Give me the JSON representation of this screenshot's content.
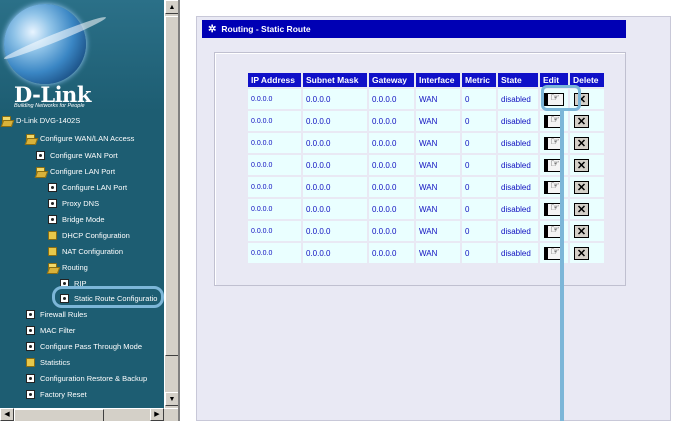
{
  "nav": {
    "brand": "D-Link",
    "tagline": "Building Networks for People",
    "tree": [
      {
        "label": "D-Link DVG-1402S",
        "icon": "folder-open-icon"
      },
      {
        "label": "Configure WAN/LAN Access",
        "icon": "folder-open-icon"
      },
      {
        "label": "Configure WAN Port",
        "icon": "page-icon"
      },
      {
        "label": "Configure LAN Port",
        "icon": "folder-open-icon"
      },
      {
        "label": "Configure LAN Port",
        "icon": "page-icon"
      },
      {
        "label": "Proxy DNS",
        "icon": "page-icon"
      },
      {
        "label": "Bridge Mode",
        "icon": "page-icon"
      },
      {
        "label": "DHCP Configuration",
        "icon": "folder-icon"
      },
      {
        "label": "NAT Configuration",
        "icon": "folder-icon"
      },
      {
        "label": "Routing",
        "icon": "folder-open-icon"
      },
      {
        "label": "RIP",
        "icon": "page-icon"
      },
      {
        "label": "Static Route Configuratio",
        "icon": "page-icon"
      },
      {
        "label": "Firewall Rules",
        "icon": "page-icon"
      },
      {
        "label": "MAC Filter",
        "icon": "page-icon"
      },
      {
        "label": "Configure Pass Through Mode",
        "icon": "page-icon"
      },
      {
        "label": "Statistics",
        "icon": "folder-icon"
      },
      {
        "label": "Configuration Restore & Backup",
        "icon": "page-icon"
      },
      {
        "label": "Factory Reset",
        "icon": "page-icon"
      }
    ]
  },
  "panel": {
    "title": "Routing - Static Route"
  },
  "table": {
    "headers": [
      "IP Address",
      "Subnet Mask",
      "Gateway",
      "Interface",
      "Metric",
      "State",
      "Edit",
      "Delete"
    ],
    "rows": [
      [
        "0.0.0.0",
        "0.0.0.0",
        "0.0.0.0",
        "WAN",
        "0",
        "disabled"
      ],
      [
        "0.0.0.0",
        "0.0.0.0",
        "0.0.0.0",
        "WAN",
        "0",
        "disabled"
      ],
      [
        "0.0.0.0",
        "0.0.0.0",
        "0.0.0.0",
        "WAN",
        "0",
        "disabled"
      ],
      [
        "0.0.0.0",
        "0.0.0.0",
        "0.0.0.0",
        "WAN",
        "0",
        "disabled"
      ],
      [
        "0.0.0.0",
        "0.0.0.0",
        "0.0.0.0",
        "WAN",
        "0",
        "disabled"
      ],
      [
        "0.0.0.0",
        "0.0.0.0",
        "0.0.0.0",
        "WAN",
        "0",
        "disabled"
      ],
      [
        "0.0.0.0",
        "0.0.0.0",
        "0.0.0.0",
        "WAN",
        "0",
        "disabled"
      ],
      [
        "0.0.0.0",
        "0.0.0.0",
        "0.0.0.0",
        "WAN",
        "0",
        "disabled"
      ]
    ],
    "delete_glyph": "✕"
  },
  "scrollbar": {
    "up": "▲",
    "down": "▼",
    "left": "◀",
    "right": "▶"
  },
  "colors": {
    "nav_bg": "#1d5d72",
    "title_bar": "#0000b4",
    "header_bg": "#1010c8",
    "cell_bg": "#eaffff",
    "highlight": "#7cb6d8"
  }
}
